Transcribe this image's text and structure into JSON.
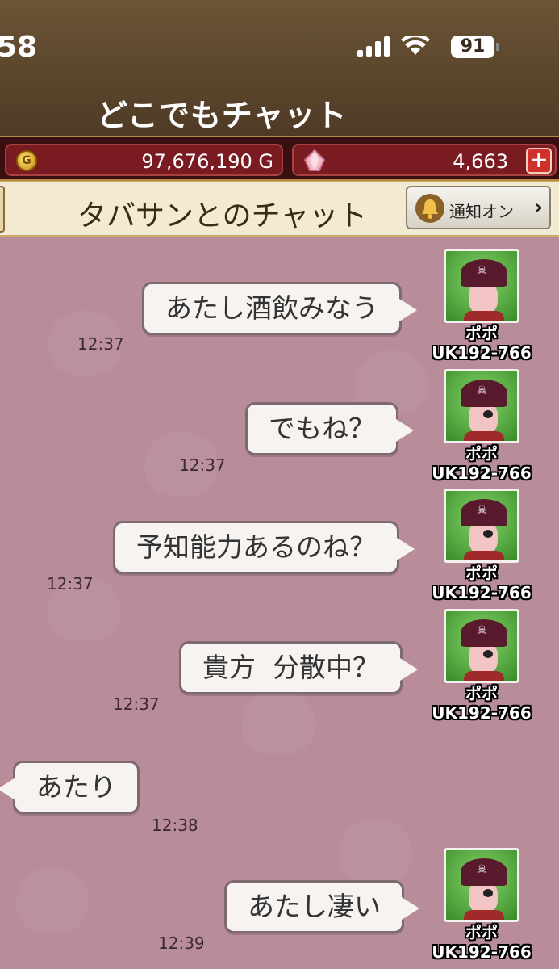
{
  "status_bar": {
    "time": "58",
    "battery": "91"
  },
  "header": {
    "title": "どこでもチャット"
  },
  "currency": {
    "gold": "97,676,190 G",
    "gems": "4,663",
    "coin_symbol": "G",
    "plus": "+"
  },
  "chat_header": {
    "title": "タバサンとのチャット",
    "notify_label": "通知オン",
    "chevron": "›"
  },
  "messages": [
    {
      "text": "あたし酒飲みなう",
      "time": "12:37",
      "sender": "ポポ",
      "id": "UK192-766"
    },
    {
      "text": "でもね？",
      "time": "12:37",
      "sender": "ポポ",
      "id": "UK192-766"
    },
    {
      "text": "予知能力あるのね？",
      "time": "12:37",
      "sender": "ポポ",
      "id": "UK192-766"
    },
    {
      "text": "貴方  分散中？",
      "time": "12:37",
      "sender": "ポポ",
      "id": "UK192-766"
    },
    {
      "text": "あたり",
      "time": "12:38"
    },
    {
      "text": "あたし凄い",
      "time": "12:39",
      "sender": "ポポ",
      "id": "UK192-766"
    }
  ],
  "colors": {
    "chat_bg": "#b98c9a",
    "header_bg": "#6b5437",
    "currency_bg": "#3a0f12",
    "bubble": "#f6f3f0"
  }
}
